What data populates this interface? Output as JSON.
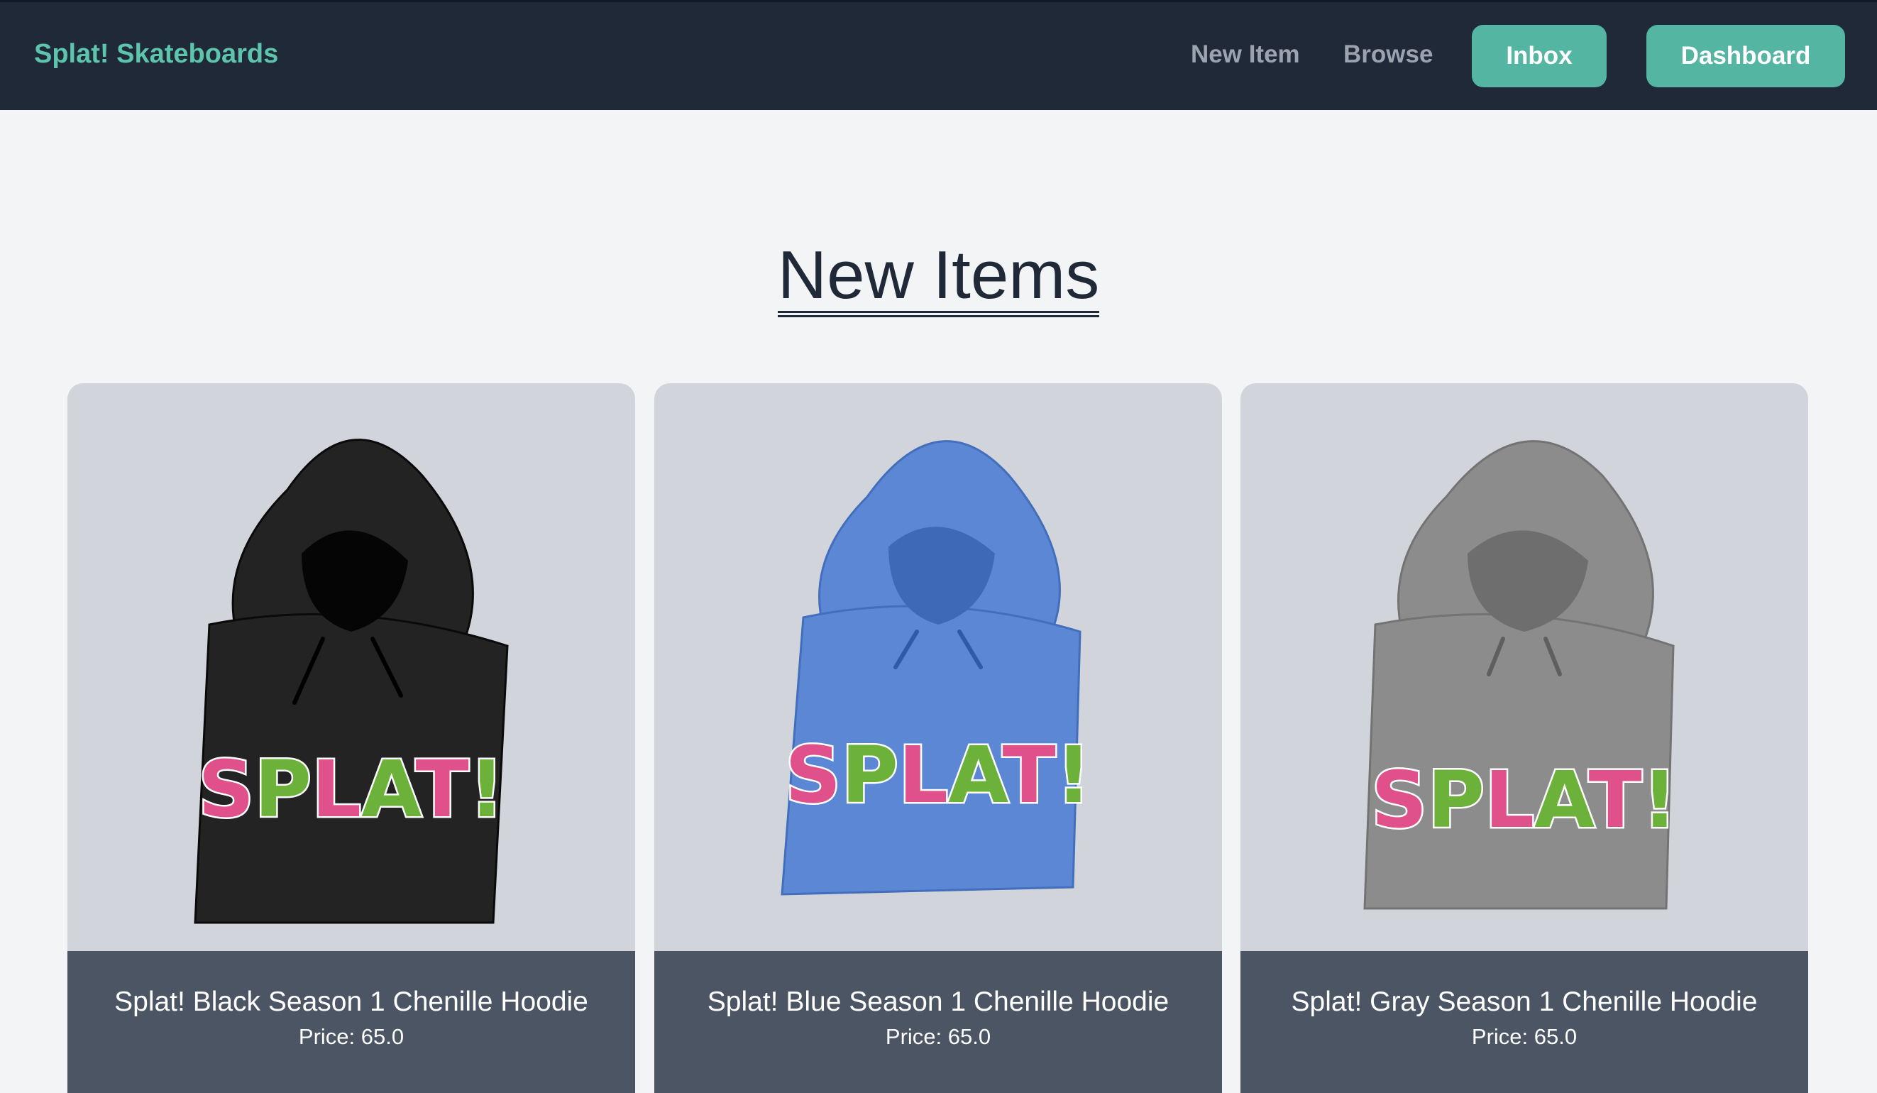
{
  "nav": {
    "brand": "Splat! Skateboards",
    "links": [
      "New Item",
      "Browse"
    ],
    "buttons": [
      "Inbox",
      "Dashboard"
    ]
  },
  "main": {
    "title": "New Items",
    "items": [
      {
        "name": "Splat! Black Season 1 Chenille Hoodie",
        "price": "Price: 65.0",
        "color": "#232323",
        "logo_text": "SPLAT!"
      },
      {
        "name": "Splat! Blue Season 1 Chenille Hoodie",
        "price": "Price: 65.0",
        "color": "#5b87d4",
        "logo_text": "SPLAT!"
      },
      {
        "name": "Splat! Gray Season 1 Chenille Hoodie",
        "price": "Price: 65.0",
        "color": "#8c8c8c",
        "logo_text": "SPLAT!"
      }
    ]
  },
  "colors": {
    "nav_bg": "#1f2937",
    "brand": "#5ec5ad",
    "button": "#54b6a2",
    "card_bg": "#d1d5db",
    "card_footer": "#4b5563",
    "logo_pink": "#e0508a",
    "logo_green": "#6cb23a"
  }
}
